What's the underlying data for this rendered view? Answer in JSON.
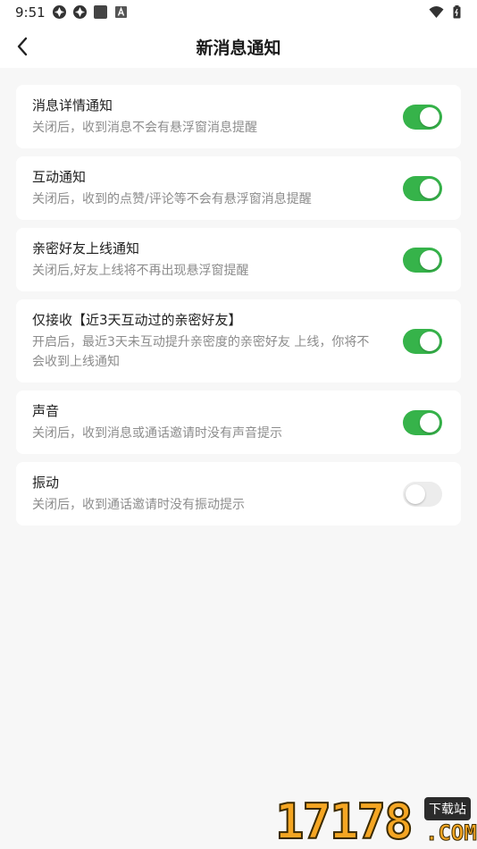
{
  "status_bar": {
    "time": "9:51",
    "icons": [
      "aperture-icon",
      "aperture-icon",
      "square-icon",
      "a-badge-icon",
      "wifi-icon",
      "battery-icon"
    ]
  },
  "header": {
    "title": "新消息通知",
    "back_icon": "back-arrow-icon"
  },
  "settings": [
    {
      "title": "消息详情通知",
      "desc": "关闭后，收到消息不会有悬浮窗消息提醒",
      "enabled": true
    },
    {
      "title": "互动通知",
      "desc": "关闭后，收到的点赞/评论等不会有悬浮窗消息提醒",
      "enabled": true
    },
    {
      "title": "亲密好友上线通知",
      "desc": "关闭后,好友上线将不再出现悬浮窗提醒",
      "enabled": true
    },
    {
      "title": "仅接收【近3天互动过的亲密好友】",
      "desc": "开启后，最近3天未互动提升亲密度的亲密好友 上线，你将不会收到上线通知",
      "enabled": true
    },
    {
      "title": "声音",
      "desc": "关闭后，收到消息或通话邀请时没有声音提示",
      "enabled": true
    },
    {
      "title": "振动",
      "desc": "关闭后，收到通话邀请时没有振动提示",
      "enabled": false
    }
  ],
  "colors": {
    "toggle_on": "#36b34a",
    "toggle_off": "#ececec",
    "background": "#f7f7f7"
  },
  "watermark": {
    "digits": "17178",
    "tag": "下载站",
    "suffix": ".COM"
  }
}
